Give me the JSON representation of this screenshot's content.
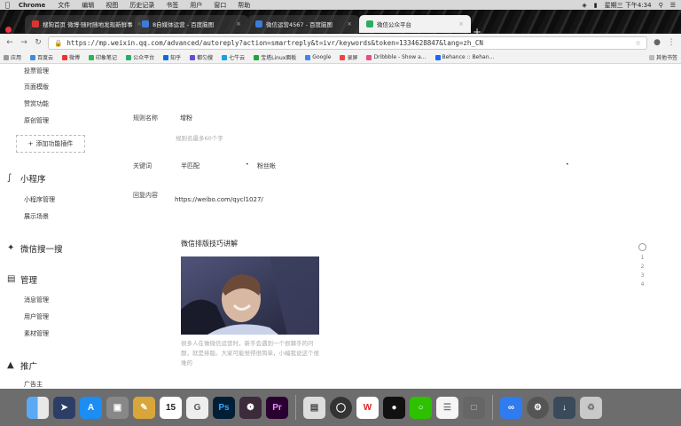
{
  "menubar": {
    "app": "Chrome",
    "items": [
      "文件",
      "编辑",
      "视图",
      "历史记录",
      "书签",
      "用户",
      "窗口",
      "帮助"
    ],
    "clock": "星期三 下午4:34"
  },
  "tabs": [
    {
      "label": "搜狗首页 微博·随时随地发现新鲜事",
      "active": false
    },
    {
      "label": "8自媒体运营 - 百度脑图",
      "active": false
    },
    {
      "label": "微信运营4567 - 百度脑图",
      "active": false
    },
    {
      "label": "微信公众平台",
      "active": true
    }
  ],
  "address": {
    "url": "https://mp.weixin.qq.com/advanced/autoreply?action=smartreply&t=ivr/keywords&token=1334628847&lang=zh_CN"
  },
  "bookmarks": {
    "items": [
      "应用",
      "百度云",
      "微博",
      "印象笔记",
      "公众平台",
      "知乎",
      "都匀搜",
      "七牛云",
      "宝塔Linux面板",
      "Google",
      "录屏",
      "Dribbble - Show a...",
      "Behance :: Behan..."
    ],
    "other": "其他书签"
  },
  "sidebar": {
    "top_items": [
      "投票管理",
      "页面模版",
      "赞赏功能",
      "原创管理"
    ],
    "add_plugin": "添加功能插件",
    "sections": [
      {
        "title": "小程序",
        "items": [
          "小程序管理",
          "展示场景"
        ]
      },
      {
        "title": "微信搜一搜",
        "items": []
      },
      {
        "title": "管理",
        "items": [
          "消息管理",
          "用户管理",
          "素材管理"
        ]
      },
      {
        "title": "推广",
        "items": [
          "广告主"
        ]
      }
    ]
  },
  "form": {
    "rule_name_label": "规则名称",
    "rule_name_value": "增粉",
    "rule_name_hint": "规则名最多60个字",
    "keyword_label": "关键词",
    "keyword_match": "半匹配",
    "keyword_value": "粉丝帐",
    "reply_label": "回复内容",
    "reply_value": "https://weibo.com/qycl1027/"
  },
  "article": {
    "title": "微信排版技巧讲解",
    "desc": "很多人在做微信运营时，新手会遇到一个很棘手的问题，就是排版。大家可能觉得很简单，小编我说这个很难的"
  },
  "scroll_indicator": [
    "1",
    "2",
    "3",
    "4"
  ],
  "dock": {
    "icons": [
      "finder-icon",
      "launchpad-icon",
      "appstore-icon",
      "preview-icon",
      "pages-icon",
      "calendar-icon",
      "git-icon",
      "photoshop-icon",
      "bug-icon",
      "premiere-icon",
      "notes-icon",
      "chrome-icon",
      "wps-icon",
      "qq-icon",
      "wechat-icon",
      "textedit-icon",
      "mockup-icon",
      "baiduwangpan-icon",
      "safari-icon",
      "trash-icon"
    ],
    "calendar_day": "15",
    "photoshop_label": "Ps",
    "premiere_label": "Pr",
    "wps_label": "W"
  }
}
